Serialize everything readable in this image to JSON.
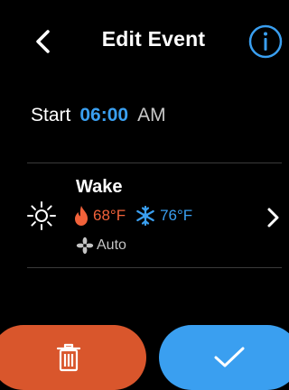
{
  "header": {
    "title": "Edit Event",
    "back_icon": "chevron-left-icon",
    "info_icon": "info-circle-icon"
  },
  "start": {
    "label": "Start",
    "time": "06:00",
    "ampm": "AM"
  },
  "event": {
    "name": "Wake",
    "icon": "sun-icon",
    "heat_setpoint": "68°F",
    "cool_setpoint": "76°F",
    "fan_mode": "Auto"
  },
  "actions": {
    "delete_icon": "trash-icon",
    "confirm_icon": "checkmark-icon"
  },
  "colors": {
    "background": "#000000",
    "accent_blue": "#3a9ff0",
    "heat_orange": "#f2623a",
    "delete_red": "#d9562c"
  }
}
